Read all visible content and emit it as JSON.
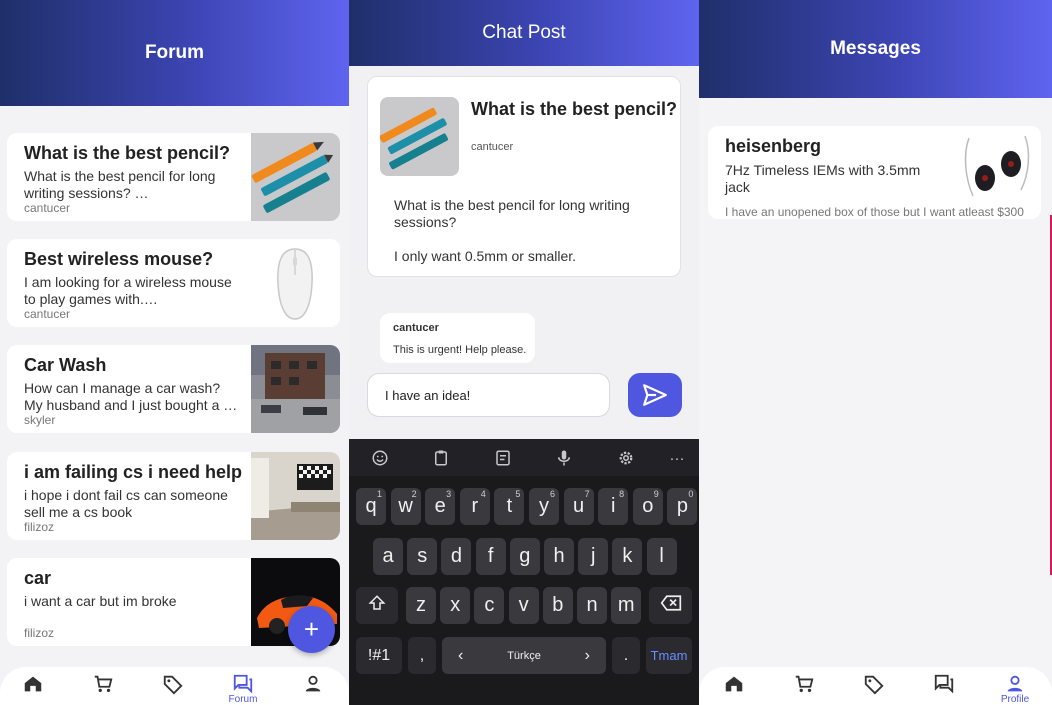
{
  "forum": {
    "title": "Forum",
    "posts": [
      {
        "title": "What is the best pencil?",
        "body": "What is the best pencil for long writing sessions? …",
        "author": "cantucer",
        "thumb": "pencils-image"
      },
      {
        "title": "Best wireless mouse?",
        "body": "I am looking for a wireless mouse to play games with.…",
        "author": "cantucer",
        "thumb": "mouse-image"
      },
      {
        "title": "Car Wash",
        "body": "How can I manage a car wash? My husband and I just bought a …",
        "author": "skyler",
        "thumb": "car-wash-image"
      },
      {
        "title": "i am failing cs i need help",
        "body": "i hope i dont fail cs can someone sell me a cs book",
        "author": "filizoz",
        "thumb": "room-image"
      },
      {
        "title": "car",
        "body": "i want a car but im broke",
        "author": "filizoz",
        "thumb": "orange-car-image"
      }
    ],
    "fab_label": "+",
    "active_tab_label": "Forum"
  },
  "chat": {
    "title": "Chat Post",
    "post_title": "What is the best pencil?",
    "post_author": "cantucer",
    "post_body": "What is the best pencil for long writing sessions?",
    "post_body2": "I only want 0.5mm or smaller.",
    "reply_author": "cantucer",
    "reply_text": "This is urgent! Help please.",
    "input_value": "I have an idea!"
  },
  "keyboard": {
    "row1": [
      [
        "q",
        "1"
      ],
      [
        "w",
        "2"
      ],
      [
        "e",
        "3"
      ],
      [
        "r",
        "4"
      ],
      [
        "t",
        "5"
      ],
      [
        "y",
        "6"
      ],
      [
        "u",
        "7"
      ],
      [
        "i",
        "8"
      ],
      [
        "o",
        "9"
      ],
      [
        "p",
        "0"
      ]
    ],
    "row2": [
      "a",
      "s",
      "d",
      "f",
      "g",
      "h",
      "j",
      "k",
      "l"
    ],
    "row3": [
      "z",
      "x",
      "c",
      "v",
      "b",
      "n",
      "m"
    ],
    "sym": "!#1",
    "comma": ",",
    "space": "Türkçe",
    "period": ".",
    "done": "Tmam",
    "left": "‹",
    "right": "›",
    "more": "···"
  },
  "messages": {
    "title": "Messages",
    "item": {
      "name": "heisenberg",
      "title": "7Hz Timeless IEMs with 3.5mm jack",
      "preview": "I have an unopened box of those but I want atleast $300"
    },
    "active_tab_label": "Profile"
  },
  "colors": {
    "accent": "#4f56e0",
    "header_start": "#1f2f6a",
    "header_end": "#5f64f0"
  }
}
